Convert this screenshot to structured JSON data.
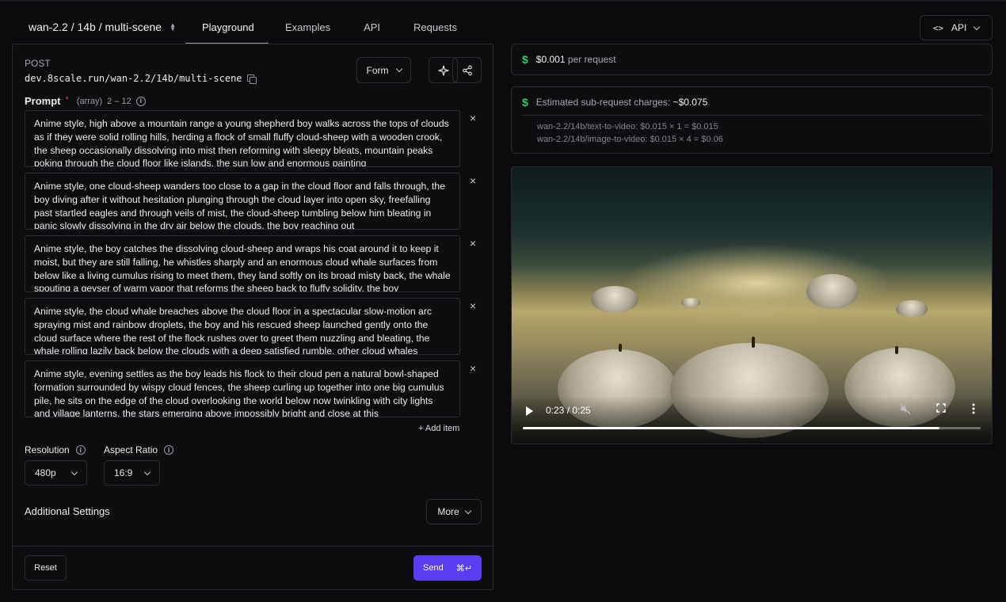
{
  "header": {
    "model": "wan-2.2 / 14b / multi-scene",
    "tabs": [
      {
        "label": "Playground"
      },
      {
        "label": "Examples"
      },
      {
        "label": "API"
      },
      {
        "label": "Requests"
      }
    ],
    "api_button_label": "API",
    "api_button_icon": "<>"
  },
  "request": {
    "method": "POST",
    "endpoint": "dev.8scale.run/wan-2.2/14b/multi-scene",
    "form_label": "Form"
  },
  "prompt": {
    "label": "Prompt",
    "required_mark": "*",
    "type": "(array)",
    "range": "2 – 12",
    "items": [
      "Anime style, high above a mountain range a young shepherd boy walks across the tops of clouds as if they were solid rolling hills, herding a flock of small fluffy cloud-sheep with a wooden crook, the sheep occasionally dissolving into mist then reforming with sleepy bleats, mountain peaks poking through the cloud floor like islands, the sun low and enormous painting",
      "Anime style, one cloud-sheep wanders too close to a gap in the cloud floor and falls through, the boy diving after it without hesitation plunging through the cloud layer into open sky, freefalling past startled eagles and through veils of mist, the cloud-sheep tumbling below him bleating in panic slowly dissolving in the dry air below the clouds, the boy reaching out",
      "Anime style, the boy catches the dissolving cloud-sheep and wraps his coat around it to keep it moist, but they are still falling, he whistles sharply and an enormous cloud whale surfaces from below like a living cumulus rising to meet them, they land softly on its broad misty back, the whale spouting a geyser of warm vapor that reforms the sheep back to fluffy solidity, the boy",
      "Anime style, the cloud whale breaches above the cloud floor in a spectacular slow-motion arc spraying mist and rainbow droplets, the boy and his rescued sheep launched gently onto the cloud surface where the rest of the flock rushes over to greet them nuzzling and bleating, the whale rolling lazily back below the clouds with a deep satisfied rumble, other cloud whales",
      "Anime style, evening settles as the boy leads his flock to their cloud pen a natural bowl-shaped formation surrounded by wispy cloud fences, the sheep curling up together into one big cumulus pile, he sits on the edge of the cloud overlooking the world below now twinkling with city lights and village lanterns, the stars emerging above impossibly bright and close at this"
    ],
    "remove_symbol": "×",
    "add_item_label": "+ Add item"
  },
  "settings": {
    "resolution": {
      "label": "Resolution",
      "value": "480p"
    },
    "aspect_ratio": {
      "label": "Aspect Ratio",
      "value": "16:9"
    },
    "additional_label": "Additional Settings",
    "more_label": "More"
  },
  "actions": {
    "reset_label": "Reset",
    "send_label": "Send",
    "send_shortcut": "⌘↵",
    "send_color": "#5a3df0"
  },
  "pricing": {
    "symbol": "$",
    "amount": "$0.001",
    "unit": "per request",
    "charges_label": "Estimated sub-request charges:",
    "charges_total": "~$0.075",
    "lines": [
      "wan-2.2/14b/text-to-video: $0.015 × 1 = $0.015",
      "wan-2.2/14b/image-to-video: $0.015 × 4 = $0.06"
    ],
    "accent": "#2ecc71"
  },
  "video": {
    "time_display": "0:23 / 0:25",
    "progress": 0.91
  }
}
